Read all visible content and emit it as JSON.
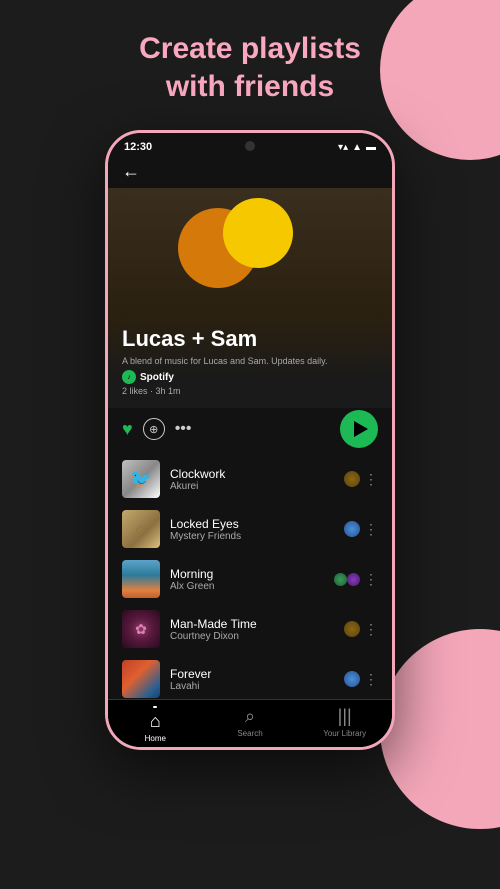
{
  "page": {
    "header_line1": "Create playlists",
    "header_line2": "with friends"
  },
  "phone": {
    "status": {
      "time": "12:30"
    },
    "playlist": {
      "title": "Lucas + Sam",
      "description": "A blend of music for Lucas and Sam. Updates daily.",
      "provider": "Spotify",
      "likes": "2 likes",
      "duration": "3h 1m"
    },
    "tracks": [
      {
        "name": "Clockwork",
        "artist": "Akurei",
        "art_style": "clockwork"
      },
      {
        "name": "Locked Eyes",
        "artist": "Mystery Friends",
        "art_style": "locked"
      },
      {
        "name": "Morning",
        "artist": "Alx Green",
        "art_style": "morning"
      },
      {
        "name": "Man-Made Time",
        "artist": "Courtney Dixon",
        "art_style": "manmade"
      },
      {
        "name": "Forever",
        "artist": "Lavahi",
        "art_style": "forever"
      }
    ],
    "nav": {
      "home": "Home",
      "search": "Search",
      "library": "Your Library"
    }
  }
}
